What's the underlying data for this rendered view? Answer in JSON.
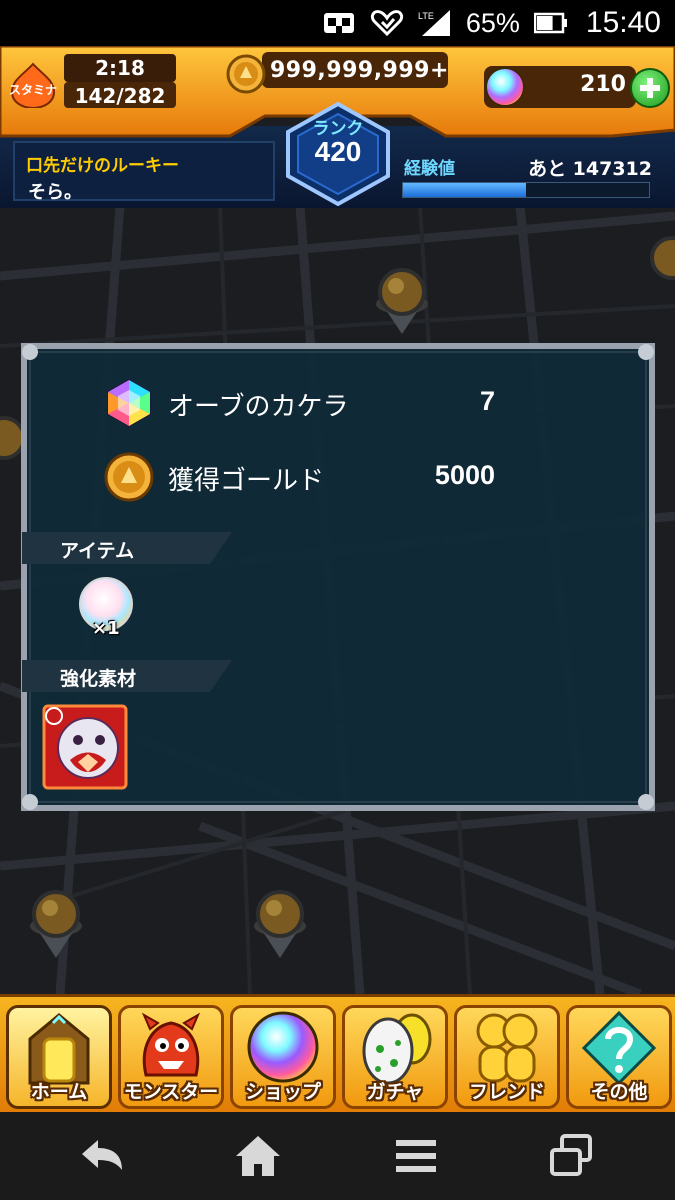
{
  "status_bar": {
    "network_label": "LTE",
    "battery_percent": "65%",
    "battery_level": 0.65,
    "time": "15:40"
  },
  "header": {
    "stamina_icon_text": "スタミナ",
    "stamina_timer": "2:18",
    "stamina_count": "142/282",
    "gold": "999,999,999+",
    "orbs": "210",
    "rank_label": "ランク",
    "rank": "420",
    "title": "口先だけのルーキー",
    "player_name": "そら。",
    "exp_label": "経験値",
    "exp_remaining": "あと 147312",
    "exp_progress": 0.5
  },
  "rewards": {
    "rows": [
      {
        "label": "オーブのカケラ",
        "value": "7",
        "icon": "orb-fragment-icon"
      },
      {
        "label": "獲得ゴールド",
        "value": "5000",
        "icon": "gold-coin-icon"
      }
    ],
    "items_header": "アイテム",
    "item_count": "×1",
    "materials_header": "強化素材"
  },
  "tabs": [
    {
      "label": "ホーム",
      "icon": "home-icon",
      "active": true
    },
    {
      "label": "モンスター",
      "icon": "monster-icon",
      "active": false
    },
    {
      "label": "ショップ",
      "icon": "shop-orb-icon",
      "active": false
    },
    {
      "label": "ガチャ",
      "icon": "gacha-egg-icon",
      "active": false
    },
    {
      "label": "フレンド",
      "icon": "friend-icon",
      "active": false
    },
    {
      "label": "その他",
      "icon": "other-icon",
      "active": false
    }
  ],
  "nav": {
    "back": "back-icon",
    "home": "home-nav-icon",
    "menu": "menu-icon",
    "recents": "recents-icon"
  },
  "colors": {
    "header_orange": "#f39a12",
    "panel_bg": "#0f2a38",
    "exp_blue": "#2d86ee",
    "accent_yellow": "#ffcc00"
  }
}
